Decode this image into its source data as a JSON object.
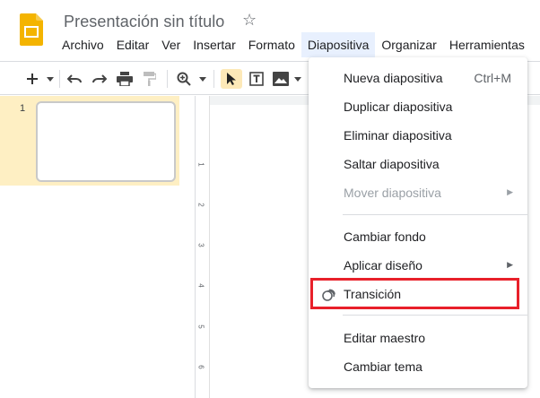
{
  "app": {
    "title": "Presentación sin título"
  },
  "menubar": [
    "Archivo",
    "Editar",
    "Ver",
    "Insertar",
    "Formato",
    "Diapositiva",
    "Organizar",
    "Herramientas"
  ],
  "filmstrip": {
    "slide_number": "1"
  },
  "ruler": [
    "1",
    "2",
    "3",
    "4",
    "5",
    "6"
  ],
  "dropdown": {
    "items": [
      {
        "label": "Nueva diapositiva",
        "shortcut": "Ctrl+M"
      },
      {
        "label": "Duplicar diapositiva"
      },
      {
        "label": "Eliminar diapositiva"
      },
      {
        "label": "Saltar diapositiva"
      },
      {
        "label": "Mover diapositiva",
        "submenu": true,
        "disabled": true
      },
      {
        "label": "Cambiar fondo"
      },
      {
        "label": "Aplicar diseño",
        "submenu": true
      },
      {
        "label": "Transición",
        "icon": "transition-icon"
      },
      {
        "label": "Editar maestro"
      },
      {
        "label": "Cambiar tema"
      }
    ]
  },
  "colors": {
    "active_menu_bg": "#e8f0fe",
    "selected_slide_bg": "#feefc3",
    "highlight_border": "#e8202a",
    "logo_yellow": "#f4b400"
  }
}
